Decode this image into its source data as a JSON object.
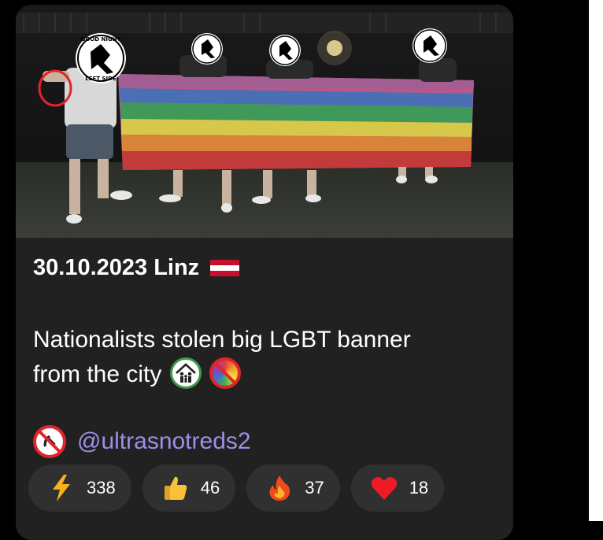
{
  "post": {
    "date_location": "30.10.2023 Linz",
    "flag_colors": [
      "#c8102e",
      "#ffffff",
      "#c8102e"
    ],
    "message_line1": "Nationalists stolen big LGBT banner",
    "message_line2": "from the city",
    "emojis_after_message": [
      "family-house-icon",
      "no-rainbow-icon"
    ],
    "source_icon": "no-communism-icon",
    "source_handle": "@ultrasnotreds2",
    "photo": {
      "description_icons": [
        "circle-highlight-icon"
      ],
      "sticker_text": [
        "GOOD NIGHT",
        "LEFT SIDE"
      ],
      "banner_colors": [
        "#b45a8a",
        "#4a6fb5",
        "#3f9a5a",
        "#d8c84a",
        "#d9823a",
        "#c23a3a"
      ]
    }
  },
  "reactions": [
    {
      "icon": "lightning-icon",
      "emoji": "⚡",
      "count": "338"
    },
    {
      "icon": "thumbs-up-icon",
      "emoji": "👍",
      "count": "46"
    },
    {
      "icon": "fire-icon",
      "emoji": "🔥",
      "count": "37"
    },
    {
      "icon": "heart-icon",
      "emoji": "❤",
      "count": "18"
    }
  ],
  "colors": {
    "card_bg": "#212121",
    "link": "#9c8fe6",
    "pill_bg": "#303030"
  }
}
